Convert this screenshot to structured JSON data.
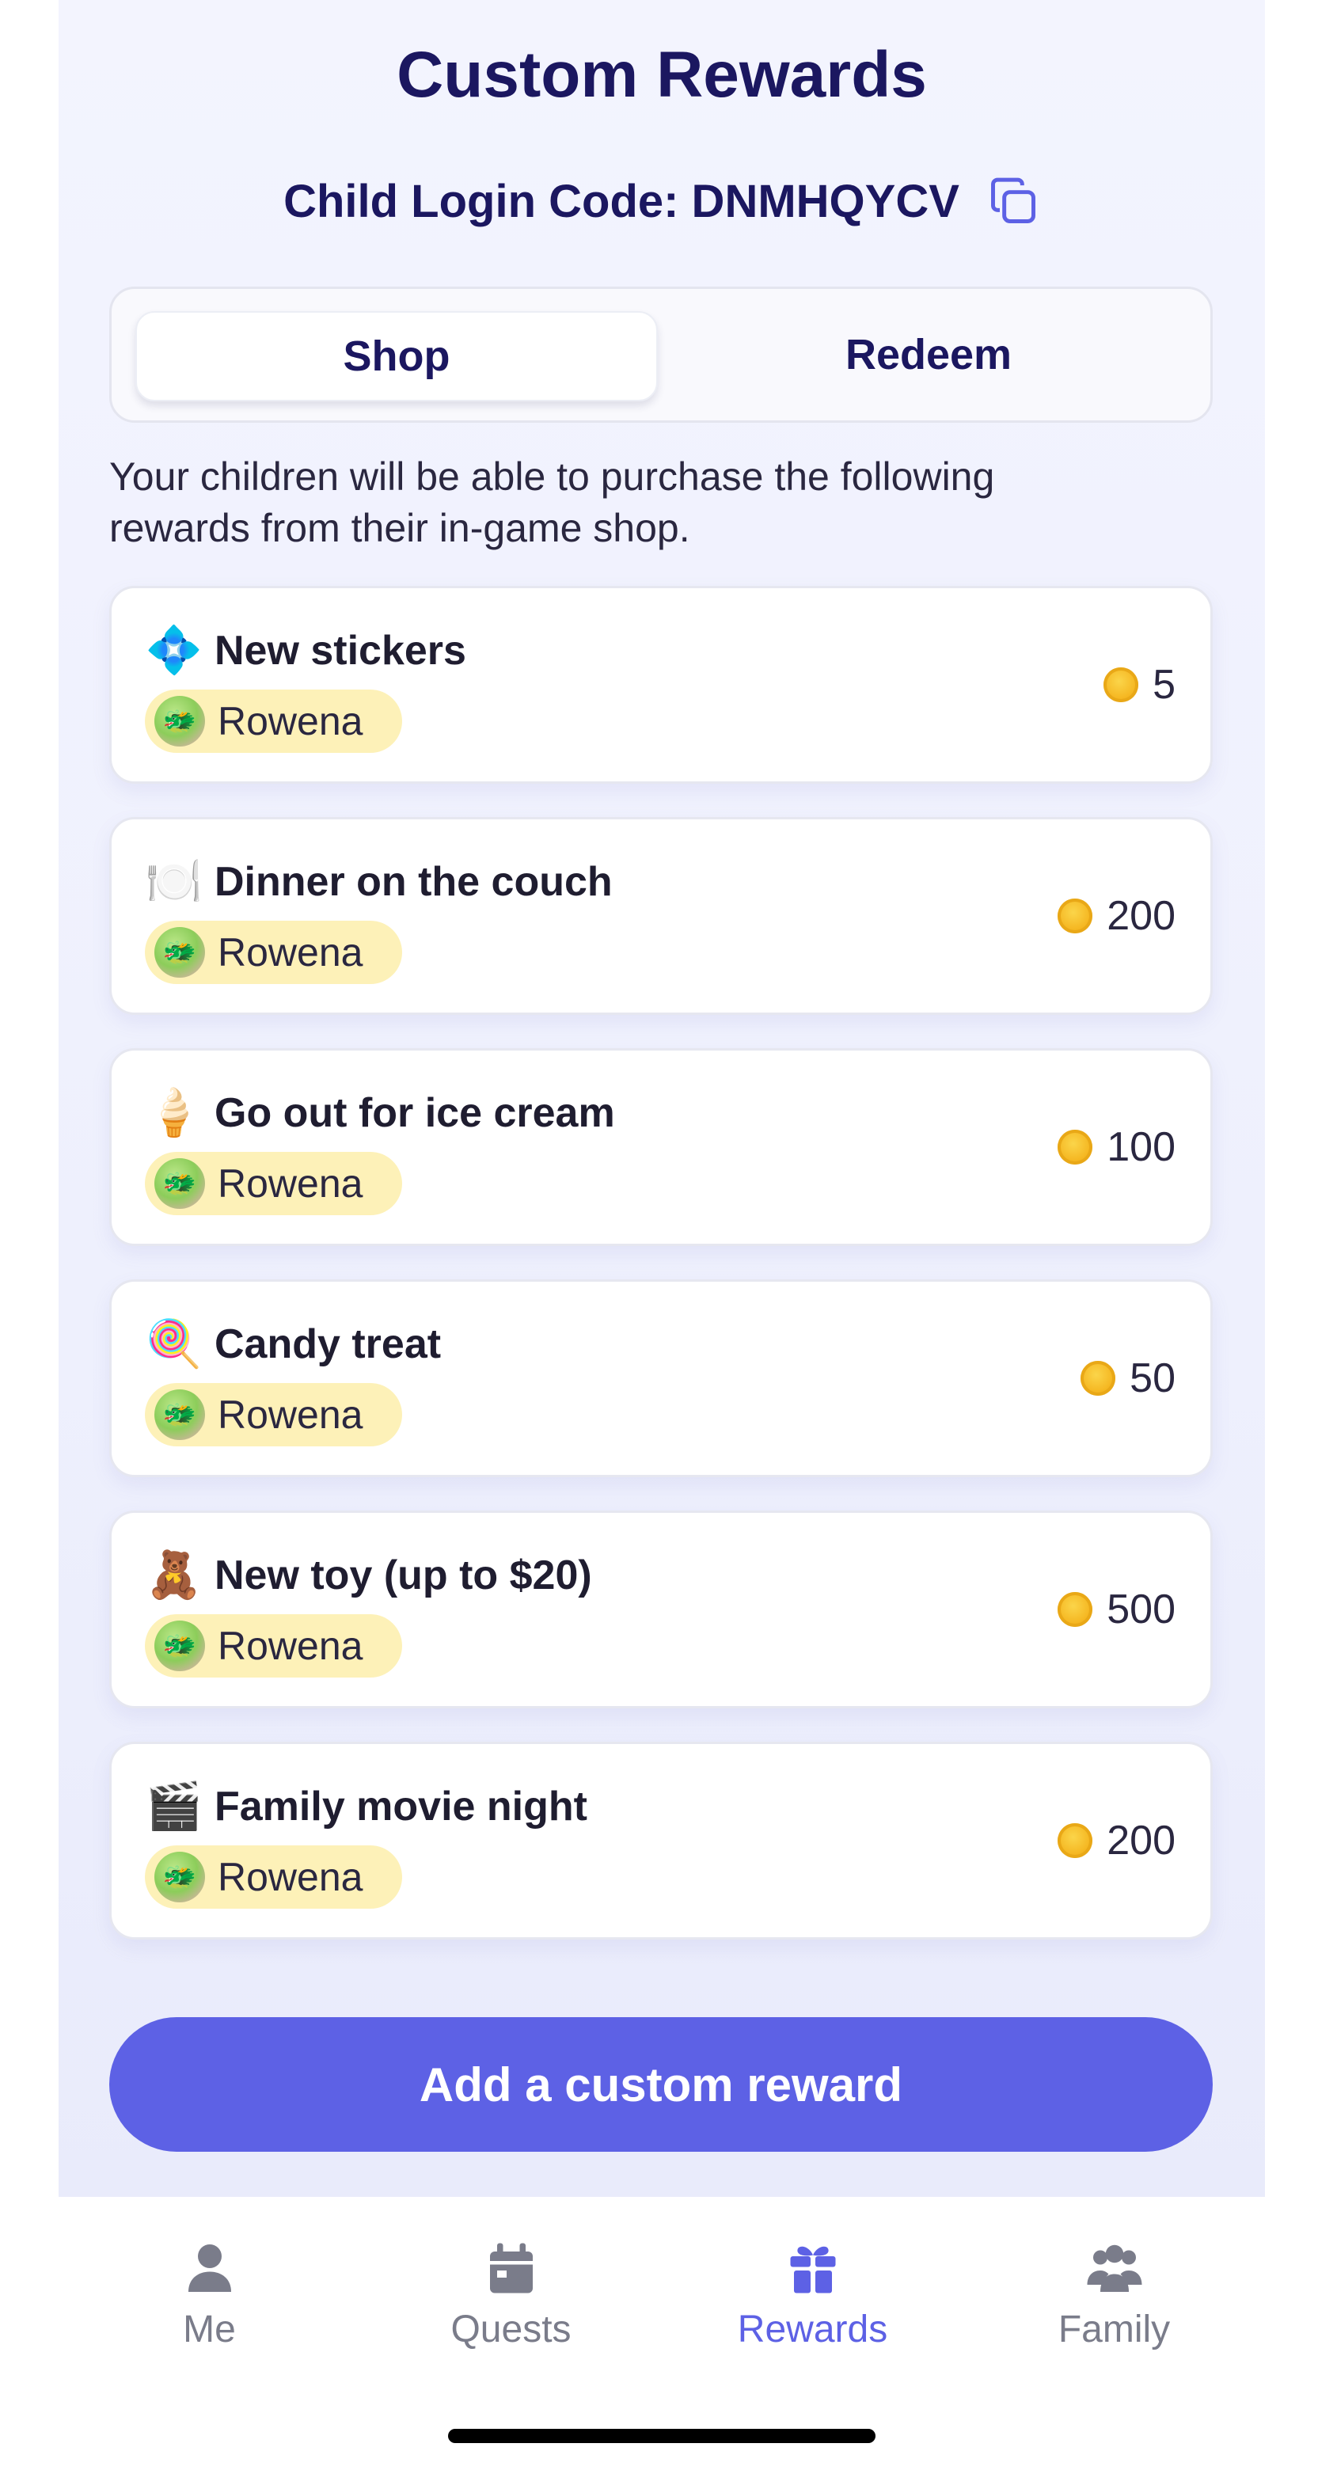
{
  "header": {
    "title": "Custom Rewards",
    "child_login_code_label": "Child Login Code: DNMHQYCV"
  },
  "segmented_control": {
    "tabs": [
      {
        "label": "Shop",
        "selected": true
      },
      {
        "label": "Redeem",
        "selected": false
      }
    ]
  },
  "intro_text": "Your children will be able to purchase the following rewards from their in-game shop.",
  "rewards": [
    {
      "emoji": "💠",
      "name": "New stickers",
      "child": "Rowena",
      "price": "5"
    },
    {
      "emoji": "🍽️",
      "name": "Dinner on the couch",
      "child": "Rowena",
      "price": "200"
    },
    {
      "emoji": "🍦",
      "name": "Go out for ice cream",
      "child": "Rowena",
      "price": "100"
    },
    {
      "emoji": "🍭",
      "name": "Candy treat",
      "child": "Rowena",
      "price": "50"
    },
    {
      "emoji": "🧸",
      "name": "New toy (up to $20)",
      "child": "Rowena",
      "price": "500"
    },
    {
      "emoji": "🎬",
      "name": "Family movie night",
      "child": "Rowena",
      "price": "200"
    }
  ],
  "add_button_label": "Add a custom reward",
  "tabbar": {
    "items": [
      {
        "label": "Me",
        "icon": "person-icon",
        "active": false
      },
      {
        "label": "Quests",
        "icon": "calendar-icon",
        "active": false
      },
      {
        "label": "Rewards",
        "icon": "gift-icon",
        "active": true
      },
      {
        "label": "Family",
        "icon": "people-icon",
        "active": false
      }
    ]
  },
  "colors": {
    "accent": "#5d61e5",
    "title": "#1b1760",
    "chip": "#fdf1b8",
    "coin": "#f5b722"
  }
}
